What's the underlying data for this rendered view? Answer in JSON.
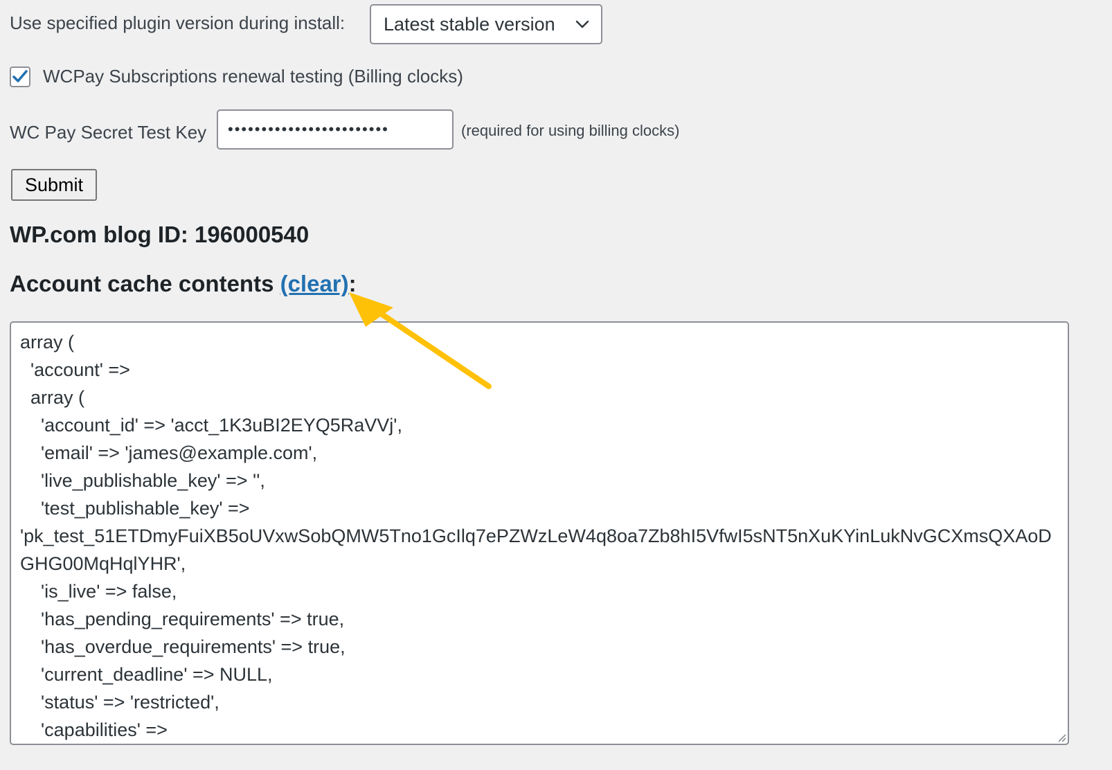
{
  "plugin_version": {
    "label": "Use specified plugin version during install:",
    "selected": "Latest stable version"
  },
  "billing_clocks": {
    "label": "WCPay Subscriptions renewal testing (Billing clocks)",
    "checked": true
  },
  "secret_key": {
    "label": "WC Pay Secret Test Key",
    "value": "••••••••••••••••••••••••",
    "hint": "(required for using billing clocks)"
  },
  "submit_label": "Submit",
  "blog_id_heading": "WP.com blog ID: 196000540",
  "cache": {
    "heading_prefix": "Account cache contents ",
    "clear_link": "(clear)",
    "heading_suffix": ":",
    "contents": "array (\n  'account' =>\n  array (\n    'account_id' => 'acct_1K3uBI2EYQ5RaVVj',\n    'email' => 'james@example.com',\n    'live_publishable_key' => '',\n    'test_publishable_key' =>\n'pk_test_51ETDmyFuiXB5oUVxwSobQMW5Tno1GcIlq7ePZWzLeW4q8oa7Zb8hI5VfwI5sNT5nXuKYinLukNvGCXmsQXAoDGHG00MqHqlYHR',\n    'is_live' => false,\n    'has_pending_requirements' => true,\n    'has_overdue_requirements' => true,\n    'current_deadline' => NULL,\n    'status' => 'restricted',\n    'capabilities' =>"
  },
  "colors": {
    "link": "#2271b1",
    "arrow": "#ffc107",
    "background": "#f0f0f1"
  },
  "icons": {
    "select_chevron": "chevron-down-icon",
    "checkbox_mark": "checkmark-icon",
    "annotation": "arrow-icon",
    "textarea_grip": "resize-grip-icon"
  }
}
